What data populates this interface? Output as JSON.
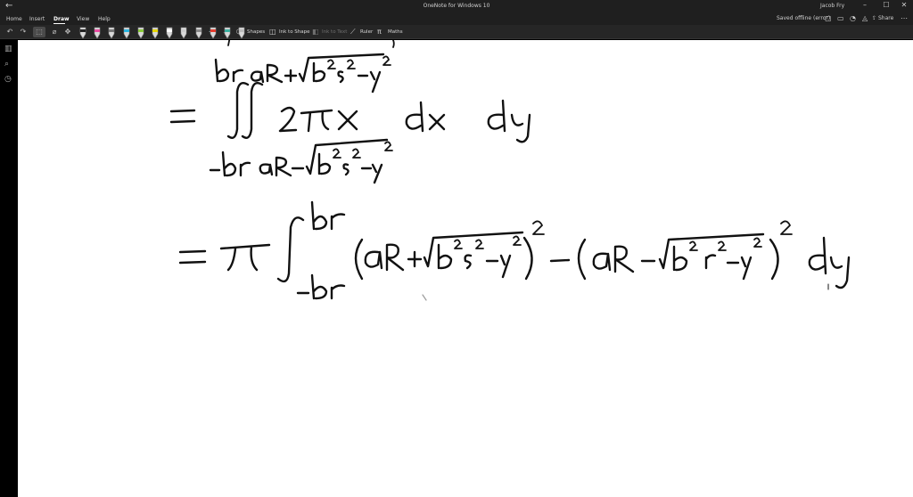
{
  "window": {
    "title": "OneNote for Windows 10",
    "user": "Jacob Fry",
    "back_glyph": "←",
    "minimize_glyph": "–",
    "maximize_glyph": "☐",
    "close_glyph": "✕"
  },
  "menu": {
    "tabs": [
      {
        "label": "Home"
      },
      {
        "label": "Insert"
      },
      {
        "label": "Draw",
        "active": true
      },
      {
        "label": "View"
      },
      {
        "label": "Help"
      }
    ],
    "status": "Saved offline (error)",
    "share_label": "Share"
  },
  "ribbon": {
    "pen_colors": [
      "#222222",
      "#e84aa0",
      "#777777",
      "#2bb5e0",
      "#8acb3a",
      "#e6d600",
      "#ffffff",
      "#cccccc",
      "#8c8c8c",
      "#e63c2e",
      "#3ab0a0",
      "#bbbbbb"
    ],
    "shapes_label": "Shapes",
    "ink_to_shape_label": "Ink to Shape",
    "ink_to_text_label": "Ink to Text",
    "ruler_label": "Ruler",
    "maths_label": "Maths"
  },
  "icons": {
    "undo": "undo-icon",
    "redo": "redo-icon",
    "lasso": "lasso-select-icon",
    "pan": "pan-icon",
    "add_pen": "add-pen-icon",
    "shapes": "shapes-icon",
    "ruler": "ruler-icon",
    "maths": "maths-icon",
    "notebooks": "notebooks-icon",
    "search": "search-icon",
    "recent": "recent-icon"
  }
}
